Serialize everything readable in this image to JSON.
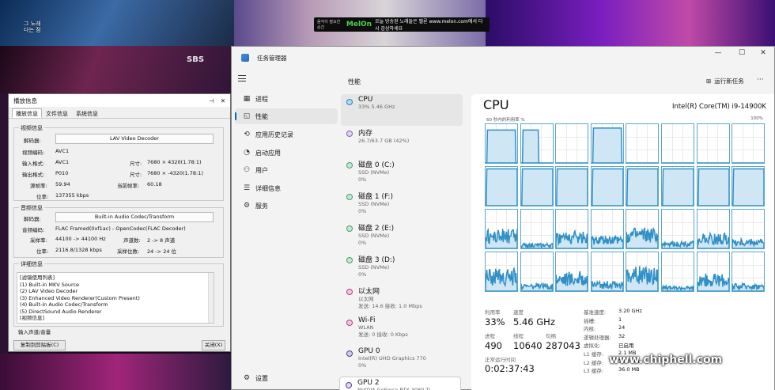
{
  "video": {
    "melon_text": "오늘 방송된 노래들은 멜론 www.melon.com에서 다시 감상하세요",
    "melon_logo": "MelOn",
    "melon_prefix": "음악이 필요한 순간",
    "sbs_logo": "SBS",
    "top_left_caption": "그 노래\n다는 점",
    "watermark_url": "www.chiphell.com",
    "watermark_logo": "chip hell"
  },
  "player_info": {
    "title": "播放信息",
    "pin": "⊣",
    "close": "✕",
    "tabs": [
      "播放信息",
      "文件信息",
      "系统信息"
    ],
    "video_group": {
      "title": "视频信息",
      "decoder_label": "解码器:",
      "decoder_value": "LAV Video Decoder",
      "codec_label": "视频编码:",
      "codec_value": "AVC1",
      "input_label": "输入格式:",
      "input_value": "AVC1",
      "size_label": "尺寸:",
      "size_in_value": "7680 × 4320(1.78:1)",
      "output_label": "输出格式:",
      "output_value": "P010",
      "size_out_value": "7680 × -4320(1.78:1)",
      "src_fps_label": "源帧率:",
      "src_fps_value": "59.94",
      "cur_fps_label": "当前帧率:",
      "cur_fps_value": "60.18",
      "bitrate_label": "位率:",
      "bitrate_value": "137355 kbps"
    },
    "audio_group": {
      "title": "音频信息",
      "decoder_label": "解码器:",
      "decoder_value": "Built-in Audio Codec/Transform",
      "codec_label": "音频编码:",
      "codec_value": "FLAC Framed(0xf1ac) - OpenCodec(FLAC Decoder)",
      "sr_label": "采样率:",
      "sr_value": "44100 -> 44100 Hz",
      "ch_label": "声道数:",
      "ch_value": "2 -> 8 声道",
      "br_label": "位率:",
      "br_value": "2116.8/1328 kbps",
      "bits_label": "采样位数:",
      "bits_value": "24 -> 24 位"
    },
    "detail_group": {
      "title": "详细信息",
      "lines": [
        "[滤镜使用列表]",
        "(1) Built-in MKV Source",
        "(2) LAV Video Decoder",
        "(3) Enhanced Video Renderer(Custom Present)",
        "(4) Built-in Audio Codec/Transform",
        "(5) DirectSound Audio Renderer",
        "[视频信息]"
      ]
    },
    "input_audio_label": "输入声道/音量",
    "copy_button": "复制到剪贴板(C)",
    "close_button": "关闭(X)"
  },
  "taskmgr": {
    "app_title": "任务管理器",
    "window_controls": [
      "—",
      "☐",
      "✕"
    ],
    "nav": [
      {
        "label": "进程",
        "icon": "▦"
      },
      {
        "label": "性能",
        "icon": "◱"
      },
      {
        "label": "应用历史记录",
        "icon": "⟲"
      },
      {
        "label": "启动应用",
        "icon": "◔"
      },
      {
        "label": "用户",
        "icon": "⚇"
      },
      {
        "label": "详细信息",
        "icon": "☰"
      },
      {
        "label": "服务",
        "icon": "⚙"
      }
    ],
    "settings_label": "设置",
    "header_title": "性能",
    "run_task": "运行新任务",
    "more": "···",
    "devices": [
      {
        "name": "CPU",
        "l1": "33% 5.46 GHz",
        "l2": "",
        "color": "#1a8ad4"
      },
      {
        "name": "内存",
        "l1": "26.7/63.7 GB (42%)",
        "l2": "",
        "color": "#8b5ec7"
      },
      {
        "name": "磁盘 0 (C:)",
        "l1": "SSD (NVMe)",
        "l2": "0%",
        "color": "#3aa56b"
      },
      {
        "name": "磁盘 1 (F:)",
        "l1": "SSD (NVMe)",
        "l2": "0%",
        "color": "#3aa56b"
      },
      {
        "name": "磁盘 2 (E:)",
        "l1": "SSD (NVMe)",
        "l2": "0%",
        "color": "#3aa56b"
      },
      {
        "name": "磁盘 3 (D:)",
        "l1": "SSD (NVMe)",
        "l2": "0%",
        "color": "#3aa56b"
      },
      {
        "name": "以太网",
        "l1": "以太网",
        "l2": "发送: 14.6 接收: 1.0 Mbps",
        "color": "#c0398b"
      },
      {
        "name": "Wi-Fi",
        "l1": "WLAN",
        "l2": "发送: 0 接收: 0 Kbps",
        "color": "#c0398b"
      },
      {
        "name": "GPU 0",
        "l1": "Intel(R) UHD Graphics 770",
        "l2": "0%",
        "color": "#5a3e98"
      },
      {
        "name": "GPU 2",
        "l1": "NVIDIA GeForce RTX 3080 Ti",
        "l2": "8%",
        "color": "#5a3e98"
      }
    ],
    "cpu": {
      "title": "CPU",
      "model": "Intel(R) Core(TM) i9-14900K",
      "graph_label": "60 秒内的利用率 %",
      "graph_max": "100%",
      "util_label": "利用率",
      "util_value": "33%",
      "speed_label": "速度",
      "speed_value": "5.46 GHz",
      "proc_label": "进程",
      "proc_value": "490",
      "thread_label": "线程",
      "thread_value": "10640",
      "handle_label": "句柄",
      "handle_value": "287043",
      "uptime_label": "正常运行时间",
      "uptime_value": "0:02:37:43",
      "specs": [
        {
          "k": "基准速度:",
          "v": "3.20 GHz"
        },
        {
          "k": "插槽:",
          "v": "1"
        },
        {
          "k": "内核:",
          "v": "24"
        },
        {
          "k": "逻辑处理器:",
          "v": "32"
        },
        {
          "k": "虚拟化:",
          "v": "已启用"
        },
        {
          "k": "L1 缓存:",
          "v": "2.1 MB"
        },
        {
          "k": "L2 缓存:",
          "v": "32.0 MB"
        },
        {
          "k": "L3 缓存:",
          "v": "36.0 MB"
        }
      ],
      "core_loads": [
        85,
        85,
        0,
        90,
        0,
        0,
        0,
        0,
        95,
        95,
        95,
        95,
        95,
        95,
        95,
        95,
        40,
        10,
        35,
        25,
        40,
        15,
        30,
        20,
        45,
        15,
        40,
        20,
        50,
        10,
        35,
        15
      ]
    }
  }
}
